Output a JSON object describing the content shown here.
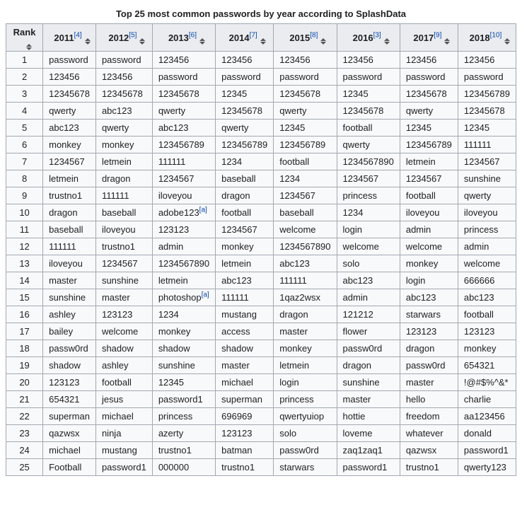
{
  "caption": "Top 25 most common passwords by year according to SplashData",
  "rank_header": "Rank",
  "years": [
    {
      "label": "2011",
      "ref": "[4]"
    },
    {
      "label": "2012",
      "ref": "[5]"
    },
    {
      "label": "2013",
      "ref": "[6]"
    },
    {
      "label": "2014",
      "ref": "[7]"
    },
    {
      "label": "2015",
      "ref": "[8]"
    },
    {
      "label": "2016",
      "ref": "[3]"
    },
    {
      "label": "2017",
      "ref": "[9]"
    },
    {
      "label": "2018",
      "ref": "[10]"
    }
  ],
  "rows": [
    {
      "rank": "1",
      "cells": [
        {
          "t": "password"
        },
        {
          "t": "password"
        },
        {
          "t": "123456"
        },
        {
          "t": "123456"
        },
        {
          "t": "123456"
        },
        {
          "t": "123456"
        },
        {
          "t": "123456"
        },
        {
          "t": "123456"
        }
      ]
    },
    {
      "rank": "2",
      "cells": [
        {
          "t": "123456"
        },
        {
          "t": "123456"
        },
        {
          "t": "password"
        },
        {
          "t": "password"
        },
        {
          "t": "password"
        },
        {
          "t": "password"
        },
        {
          "t": "password"
        },
        {
          "t": "password"
        }
      ]
    },
    {
      "rank": "3",
      "cells": [
        {
          "t": "12345678"
        },
        {
          "t": "12345678"
        },
        {
          "t": "12345678"
        },
        {
          "t": "12345"
        },
        {
          "t": "12345678"
        },
        {
          "t": "12345"
        },
        {
          "t": "12345678"
        },
        {
          "t": "123456789"
        }
      ]
    },
    {
      "rank": "4",
      "cells": [
        {
          "t": "qwerty"
        },
        {
          "t": "abc123"
        },
        {
          "t": "qwerty"
        },
        {
          "t": "12345678"
        },
        {
          "t": "qwerty"
        },
        {
          "t": "12345678"
        },
        {
          "t": "qwerty"
        },
        {
          "t": "12345678"
        }
      ]
    },
    {
      "rank": "5",
      "cells": [
        {
          "t": "abc123"
        },
        {
          "t": "qwerty"
        },
        {
          "t": "abc123"
        },
        {
          "t": "qwerty"
        },
        {
          "t": "12345"
        },
        {
          "t": "football"
        },
        {
          "t": "12345"
        },
        {
          "t": "12345"
        }
      ]
    },
    {
      "rank": "6",
      "cells": [
        {
          "t": "monkey"
        },
        {
          "t": "monkey"
        },
        {
          "t": "123456789"
        },
        {
          "t": "123456789"
        },
        {
          "t": "123456789"
        },
        {
          "t": "qwerty"
        },
        {
          "t": "123456789"
        },
        {
          "t": "111111"
        }
      ]
    },
    {
      "rank": "7",
      "cells": [
        {
          "t": "1234567"
        },
        {
          "t": "letmein"
        },
        {
          "t": "111111"
        },
        {
          "t": "1234"
        },
        {
          "t": "football"
        },
        {
          "t": "1234567890"
        },
        {
          "t": "letmein"
        },
        {
          "t": "1234567"
        }
      ]
    },
    {
      "rank": "8",
      "cells": [
        {
          "t": "letmein"
        },
        {
          "t": "dragon"
        },
        {
          "t": "1234567"
        },
        {
          "t": "baseball"
        },
        {
          "t": "1234"
        },
        {
          "t": "1234567"
        },
        {
          "t": "1234567"
        },
        {
          "t": "sunshine"
        }
      ]
    },
    {
      "rank": "9",
      "cells": [
        {
          "t": "trustno1"
        },
        {
          "t": "111111"
        },
        {
          "t": "iloveyou"
        },
        {
          "t": "dragon"
        },
        {
          "t": "1234567"
        },
        {
          "t": "princess"
        },
        {
          "t": "football"
        },
        {
          "t": "qwerty"
        }
      ]
    },
    {
      "rank": "10",
      "cells": [
        {
          "t": "dragon"
        },
        {
          "t": "baseball"
        },
        {
          "t": "adobe123",
          "note": "[a]"
        },
        {
          "t": "football"
        },
        {
          "t": "baseball"
        },
        {
          "t": "1234"
        },
        {
          "t": "iloveyou"
        },
        {
          "t": "iloveyou"
        }
      ]
    },
    {
      "rank": "11",
      "cells": [
        {
          "t": "baseball"
        },
        {
          "t": "iloveyou"
        },
        {
          "t": "123123"
        },
        {
          "t": "1234567"
        },
        {
          "t": "welcome"
        },
        {
          "t": "login"
        },
        {
          "t": "admin"
        },
        {
          "t": "princess"
        }
      ]
    },
    {
      "rank": "12",
      "cells": [
        {
          "t": "111111"
        },
        {
          "t": "trustno1"
        },
        {
          "t": "admin"
        },
        {
          "t": "monkey"
        },
        {
          "t": "1234567890"
        },
        {
          "t": "welcome"
        },
        {
          "t": "welcome"
        },
        {
          "t": "admin"
        }
      ]
    },
    {
      "rank": "13",
      "cells": [
        {
          "t": "iloveyou"
        },
        {
          "t": "1234567"
        },
        {
          "t": "1234567890"
        },
        {
          "t": "letmein"
        },
        {
          "t": "abc123"
        },
        {
          "t": "solo"
        },
        {
          "t": "monkey"
        },
        {
          "t": "welcome"
        }
      ]
    },
    {
      "rank": "14",
      "cells": [
        {
          "t": "master"
        },
        {
          "t": "sunshine"
        },
        {
          "t": "letmein"
        },
        {
          "t": "abc123"
        },
        {
          "t": "111111"
        },
        {
          "t": "abc123"
        },
        {
          "t": "login"
        },
        {
          "t": "666666"
        }
      ]
    },
    {
      "rank": "15",
      "cells": [
        {
          "t": "sunshine"
        },
        {
          "t": "master"
        },
        {
          "t": "photoshop",
          "note": "[a]"
        },
        {
          "t": "111111"
        },
        {
          "t": "1qaz2wsx"
        },
        {
          "t": "admin"
        },
        {
          "t": "abc123"
        },
        {
          "t": "abc123"
        }
      ]
    },
    {
      "rank": "16",
      "cells": [
        {
          "t": "ashley"
        },
        {
          "t": "123123"
        },
        {
          "t": "1234"
        },
        {
          "t": "mustang"
        },
        {
          "t": "dragon"
        },
        {
          "t": "121212"
        },
        {
          "t": "starwars"
        },
        {
          "t": "football"
        }
      ]
    },
    {
      "rank": "17",
      "cells": [
        {
          "t": "bailey"
        },
        {
          "t": "welcome"
        },
        {
          "t": "monkey"
        },
        {
          "t": "access"
        },
        {
          "t": "master"
        },
        {
          "t": "flower"
        },
        {
          "t": "123123"
        },
        {
          "t": "123123"
        }
      ]
    },
    {
      "rank": "18",
      "cells": [
        {
          "t": "passw0rd"
        },
        {
          "t": "shadow"
        },
        {
          "t": "shadow"
        },
        {
          "t": "shadow"
        },
        {
          "t": "monkey"
        },
        {
          "t": "passw0rd"
        },
        {
          "t": "dragon"
        },
        {
          "t": "monkey"
        }
      ]
    },
    {
      "rank": "19",
      "cells": [
        {
          "t": "shadow"
        },
        {
          "t": "ashley"
        },
        {
          "t": "sunshine"
        },
        {
          "t": "master"
        },
        {
          "t": "letmein"
        },
        {
          "t": "dragon"
        },
        {
          "t": "passw0rd"
        },
        {
          "t": "654321"
        }
      ]
    },
    {
      "rank": "20",
      "cells": [
        {
          "t": "123123"
        },
        {
          "t": "football"
        },
        {
          "t": "12345"
        },
        {
          "t": "michael"
        },
        {
          "t": "login"
        },
        {
          "t": "sunshine"
        },
        {
          "t": "master"
        },
        {
          "t": "!@#$%^&*"
        }
      ]
    },
    {
      "rank": "21",
      "cells": [
        {
          "t": "654321"
        },
        {
          "t": "jesus"
        },
        {
          "t": "password1"
        },
        {
          "t": "superman"
        },
        {
          "t": "princess"
        },
        {
          "t": "master"
        },
        {
          "t": "hello"
        },
        {
          "t": "charlie"
        }
      ]
    },
    {
      "rank": "22",
      "cells": [
        {
          "t": "superman"
        },
        {
          "t": "michael"
        },
        {
          "t": "princess"
        },
        {
          "t": "696969"
        },
        {
          "t": "qwertyuiop"
        },
        {
          "t": "hottie"
        },
        {
          "t": "freedom"
        },
        {
          "t": "aa123456"
        }
      ]
    },
    {
      "rank": "23",
      "cells": [
        {
          "t": "qazwsx"
        },
        {
          "t": "ninja"
        },
        {
          "t": "azerty"
        },
        {
          "t": "123123"
        },
        {
          "t": "solo"
        },
        {
          "t": "loveme"
        },
        {
          "t": "whatever"
        },
        {
          "t": "donald"
        }
      ]
    },
    {
      "rank": "24",
      "cells": [
        {
          "t": "michael"
        },
        {
          "t": "mustang"
        },
        {
          "t": "trustno1"
        },
        {
          "t": "batman"
        },
        {
          "t": "passw0rd"
        },
        {
          "t": "zaq1zaq1"
        },
        {
          "t": "qazwsx"
        },
        {
          "t": "password1"
        }
      ]
    },
    {
      "rank": "25",
      "cells": [
        {
          "t": "Football"
        },
        {
          "t": "password1"
        },
        {
          "t": "000000"
        },
        {
          "t": "trustno1"
        },
        {
          "t": "starwars"
        },
        {
          "t": "password1"
        },
        {
          "t": "trustno1"
        },
        {
          "t": "qwerty123"
        }
      ]
    }
  ]
}
